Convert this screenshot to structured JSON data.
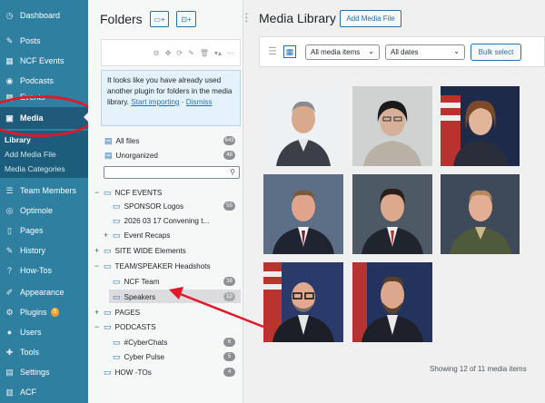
{
  "sidebar": {
    "items": [
      {
        "label": "Dashboard",
        "icon": "dashboard-icon",
        "glyph": "◷"
      },
      {
        "label": "Posts",
        "icon": "pushpin-icon",
        "glyph": "✎"
      },
      {
        "label": "NCF Events",
        "icon": "calendar-icon",
        "glyph": "▦"
      },
      {
        "label": "Podcasts",
        "icon": "microphone-icon",
        "glyph": "◉"
      },
      {
        "label": "Events",
        "icon": "calendar-icon",
        "glyph": "▦"
      },
      {
        "label": "Media",
        "icon": "media-icon",
        "glyph": "▣"
      },
      {
        "label": "Team Members",
        "icon": "team-icon",
        "glyph": "☰"
      },
      {
        "label": "Optimole",
        "icon": "optimole-icon",
        "glyph": "◎"
      },
      {
        "label": "Pages",
        "icon": "pages-icon",
        "glyph": "▯"
      },
      {
        "label": "History",
        "icon": "pushpin-icon",
        "glyph": "✎"
      },
      {
        "label": "How-Tos",
        "icon": "help-icon",
        "glyph": "?"
      },
      {
        "label": "Appearance",
        "icon": "brush-icon",
        "glyph": "✐"
      },
      {
        "label": "Plugins",
        "icon": "plugin-icon",
        "glyph": "⚙",
        "badge": "6"
      },
      {
        "label": "Users",
        "icon": "user-icon",
        "glyph": "●"
      },
      {
        "label": "Tools",
        "icon": "wrench-icon",
        "glyph": "✚"
      },
      {
        "label": "Settings",
        "icon": "settings-icon",
        "glyph": "▤"
      },
      {
        "label": "ACF",
        "icon": "acf-icon",
        "glyph": "▥"
      }
    ],
    "media_submenu": [
      "Library",
      "Add Media File",
      "Media Categories"
    ]
  },
  "folders": {
    "title": "Folders",
    "new_folder_btn": "▭+",
    "new_subfolder_btn": "⊡+",
    "toolbar_icons": [
      "⚙",
      "✥",
      "⟳",
      "✎",
      "🗑",
      "▾▴",
      "⋯"
    ],
    "notice_text": "It looks like you have already used another plugin for folders in the media library.",
    "notice_link": "Start importing",
    "notice_sep": " · ",
    "notice_dismiss": "Dismiss",
    "all_files": {
      "label": "All files",
      "count": "643"
    },
    "unorganized": {
      "label": "Unorganized",
      "count": "48"
    },
    "tree": [
      {
        "label": "NCF EVENTS",
        "depth": 0,
        "toggle": "−"
      },
      {
        "label": "SPONSOR Logos",
        "depth": 1,
        "toggle": "",
        "count": "55"
      },
      {
        "label": "2026 03 17 Convening t...",
        "depth": 1,
        "toggle": ""
      },
      {
        "label": "Event Recaps",
        "depth": 1,
        "toggle": "+"
      },
      {
        "label": "SITE WIDE Elements",
        "depth": 0,
        "toggle": "+"
      },
      {
        "label": "TEAM/SPEAKER Headshots",
        "depth": 0,
        "toggle": "−"
      },
      {
        "label": "NCF Team",
        "depth": 1,
        "toggle": "",
        "count": "38"
      },
      {
        "label": "Speakers",
        "depth": 1,
        "toggle": "",
        "count": "12"
      },
      {
        "label": "PAGES",
        "depth": 0,
        "toggle": "+"
      },
      {
        "label": "PODCASTS",
        "depth": 0,
        "toggle": "−"
      },
      {
        "label": "#CyberChats",
        "depth": 1,
        "toggle": "",
        "count": "6"
      },
      {
        "label": "Cyber Pulse",
        "depth": 1,
        "toggle": "",
        "count": "5"
      },
      {
        "label": "HOW -TOs",
        "depth": 0,
        "toggle": "",
        "count": "4"
      }
    ]
  },
  "media": {
    "title": "Media Library",
    "add_button": "Add Media File",
    "filter_type": "All media items",
    "filter_date": "All dates",
    "bulk_select": "Bulk select",
    "showing": "Showing 12 of 11 media items",
    "list_view_glyph": "☰",
    "grid_view_glyph": "▦",
    "chevron_glyph": "⌄",
    "search_glyph": "⚲"
  },
  "colors": {
    "sidebar_bg": "#2f7fa0",
    "active_bg": "#1f5a7a",
    "accent": "#2271b1",
    "annotation_red": "#e0182a"
  }
}
